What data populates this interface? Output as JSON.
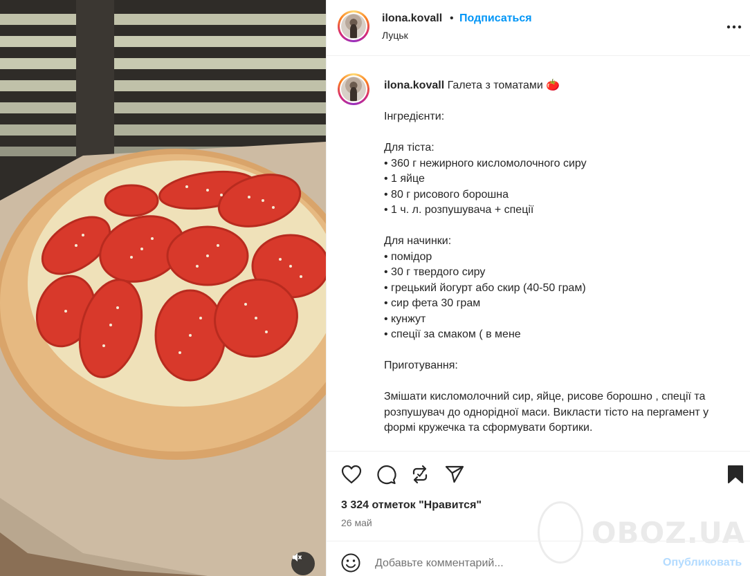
{
  "header": {
    "username": "ilona.kovall",
    "separator": "•",
    "follow_label": "Подписаться",
    "location": "Луцьк",
    "more_icon": "more-horizontal-icon"
  },
  "caption": {
    "username": "ilona.kovall",
    "title": "Галета з томатами",
    "emoji": "🍅",
    "lines": [
      "Інгредієнти:",
      "",
      "Для тіста:",
      "• 360 г нежирного кисломолочного сиру",
      "• 1 яйце",
      "• 80 г рисового борошна",
      "• 1 ч. л. розпушувача + спеції",
      "",
      "Для начинки:",
      "• помідор",
      "• 30 г твердого сиру",
      "• грецький йогурт або скир (40-50 грам)",
      "• сир фета 30 грам",
      "• кунжут",
      "• спеції за смаком ( в мене",
      "",
      "Приготування:",
      "",
      "Змішати кисломолочний сир, яйце, рисове борошно , спеції та",
      "розпушувач до однорідної маси. Викласти тісто на пергамент у",
      "формі кружечка та сформувати бортики."
    ]
  },
  "actions": {
    "like_icon": "heart-icon",
    "comment_icon": "comment-icon",
    "repost_icon": "repost-icon",
    "share_icon": "send-icon",
    "save_icon": "bookmark-icon"
  },
  "likes": "3 324 отметок \"Нравится\"",
  "date": "26 май",
  "comment": {
    "placeholder": "Добавьте комментарий...",
    "post_label": "Опубликовать",
    "emoji_icon": "smiley-icon"
  },
  "media": {
    "mute_icon": "sound-off-icon"
  },
  "watermark": "OBOZ.UA",
  "colors": {
    "accent": "#0095f6",
    "post_disabled": "#b3dbff",
    "text": "#262626",
    "muted": "#737373"
  }
}
